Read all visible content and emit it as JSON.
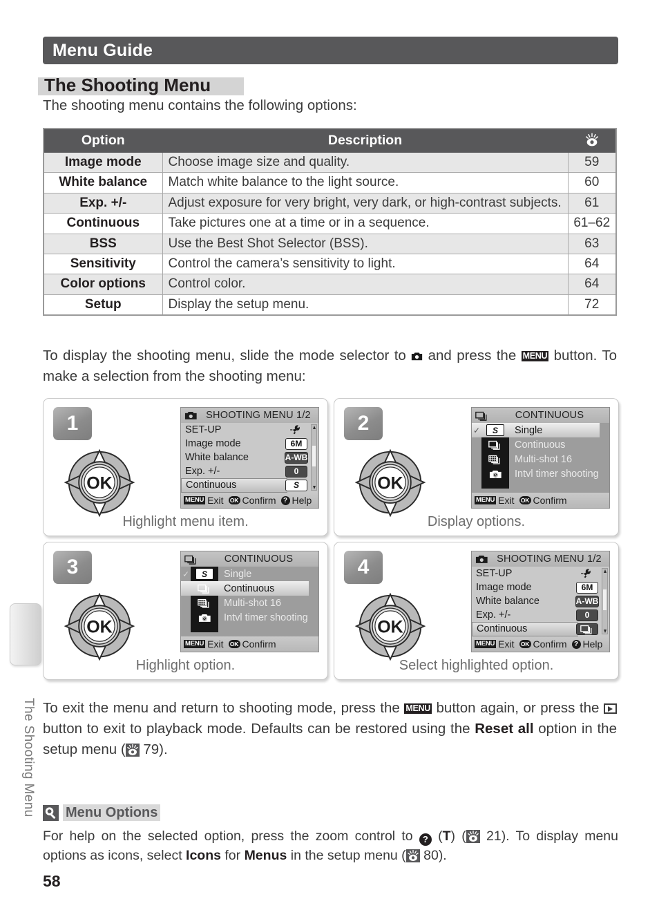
{
  "header": {
    "title": "Menu Guide"
  },
  "section": {
    "title": "The Shooting Menu",
    "lede": "The shooting menu contains the following options:"
  },
  "table": {
    "headers": {
      "option": "Option",
      "description": "Description",
      "page": "eye-ref-icon"
    },
    "rows": [
      {
        "option": "Image mode",
        "description": "Choose image size and quality.",
        "page": "59"
      },
      {
        "option": "White balance",
        "description": "Match white balance to the light source.",
        "page": "60"
      },
      {
        "option": "Exp. +/-",
        "description": "Adjust exposure for very bright, very dark, or high-contrast subjects.",
        "page": "61"
      },
      {
        "option": "Continuous",
        "description": "Take pictures one at a time or in a sequence.",
        "page": "61–62"
      },
      {
        "option": "BSS",
        "description": "Use the Best Shot Selector (BSS).",
        "page": "63"
      },
      {
        "option": "Sensitivity",
        "description": "Control the camera’s sensitivity to light.",
        "page": "64"
      },
      {
        "option": "Color options",
        "description": "Control color.",
        "page": "64"
      },
      {
        "option": "Setup",
        "description": "Display the setup menu.",
        "page": "72"
      }
    ]
  },
  "para_display": {
    "p1": "To display the shooting menu, slide the mode selector to ",
    "p2": " and press the ",
    "menu_label": "MENU",
    "p3": " button.  To make a selection from the shooting menu:"
  },
  "para_exit": {
    "p1": "To exit the menu and return to shooting mode, press the ",
    "menu_label": "MENU",
    "p2": " button again, or press the ",
    "p3": " button to exit to playback mode.  Defaults can be restored using the ",
    "bold1": "Reset all",
    "p4": " option in the setup menu (",
    "ref": "79",
    "p5": ")."
  },
  "steps": [
    {
      "number": "1",
      "caption": "Highlight menu item.",
      "screen": {
        "kind": "menu",
        "title": "SHOOTING MENU  1/2",
        "title_icon": "camera-icon",
        "items": [
          {
            "label": "SET-UP",
            "value": "wrench-icon",
            "selected": false
          },
          {
            "label": "Image mode",
            "value": "6M",
            "selected": false
          },
          {
            "label": "White balance",
            "value": "A-WB",
            "selected": false
          },
          {
            "label": "Exp. +/-",
            "value": "0",
            "selected": false
          },
          {
            "label": "Continuous",
            "value": "S",
            "selected": true
          }
        ],
        "footer": [
          {
            "key": "MENU",
            "label": "Exit"
          },
          {
            "key": "OK",
            "label": "Confirm"
          },
          {
            "key": "?",
            "label": "Help"
          }
        ]
      }
    },
    {
      "number": "2",
      "caption": "Display options.",
      "screen": {
        "kind": "options",
        "title": "CONTINUOUS",
        "title_icon": "continuous-icon",
        "items": [
          {
            "label": "Single",
            "icon": "single-icon",
            "checked": true,
            "selected": true
          },
          {
            "label": "Continuous",
            "icon": "continuous-icon",
            "checked": false,
            "selected": false
          },
          {
            "label": "Multi-shot 16",
            "icon": "multishot-icon",
            "checked": false,
            "selected": false
          },
          {
            "label": "Intvl timer shooting",
            "icon": "intvl-timer-icon",
            "checked": false,
            "selected": false
          }
        ],
        "footer": [
          {
            "key": "MENU",
            "label": "Exit"
          },
          {
            "key": "OK",
            "label": "Confirm"
          }
        ]
      }
    },
    {
      "number": "3",
      "caption": "Highlight option.",
      "screen": {
        "kind": "options",
        "title": "CONTINUOUS",
        "title_icon": "continuous-icon",
        "items": [
          {
            "label": "Single",
            "icon": "single-icon",
            "checked": true,
            "selected": false
          },
          {
            "label": "Continuous",
            "icon": "continuous-icon",
            "checked": false,
            "selected": true
          },
          {
            "label": "Multi-shot 16",
            "icon": "multishot-icon",
            "checked": false,
            "selected": false
          },
          {
            "label": "Intvl timer shooting",
            "icon": "intvl-timer-icon",
            "checked": false,
            "selected": false
          }
        ],
        "footer": [
          {
            "key": "MENU",
            "label": "Exit"
          },
          {
            "key": "OK",
            "label": "Confirm"
          }
        ]
      }
    },
    {
      "number": "4",
      "caption": "Select highlighted option.",
      "screen": {
        "kind": "menu",
        "title": "SHOOTING MENU  1/2",
        "title_icon": "camera-icon",
        "items": [
          {
            "label": "SET-UP",
            "value": "wrench-icon",
            "selected": false
          },
          {
            "label": "Image mode",
            "value": "6M",
            "selected": false
          },
          {
            "label": "White balance",
            "value": "A-WB",
            "selected": false
          },
          {
            "label": "Exp. +/-",
            "value": "0",
            "selected": false
          },
          {
            "label": "Continuous",
            "value": "continuous-icon",
            "selected": true
          }
        ],
        "footer": [
          {
            "key": "MENU",
            "label": "Exit"
          },
          {
            "key": "OK",
            "label": "Confirm"
          },
          {
            "key": "?",
            "label": "Help"
          }
        ]
      }
    }
  ],
  "dpad": {
    "label": "OK"
  },
  "side_tab": {
    "label": "The Shooting Menu"
  },
  "note": {
    "icon": "tip-bulb-icon",
    "title": "Menu Options",
    "t1": "For help on the selected option, press the zoom control to ",
    "t2": " (",
    "t_bold": "T",
    "t3": ") (",
    "ref1": "21",
    "t4": ").  To display menu options as icons, select ",
    "b_icons": "Icons",
    "t5": " for ",
    "b_menus": "Menus",
    "t6": " in the setup menu (",
    "ref2": "80",
    "t7": ")."
  },
  "page_number": "58",
  "colors": {
    "header_bar": "#58585a",
    "heading_highlight": "#d4d4d4",
    "row_alt": "#e7e7e7",
    "body_text": "#3b3b3b",
    "caption": "#6d6d6d"
  }
}
